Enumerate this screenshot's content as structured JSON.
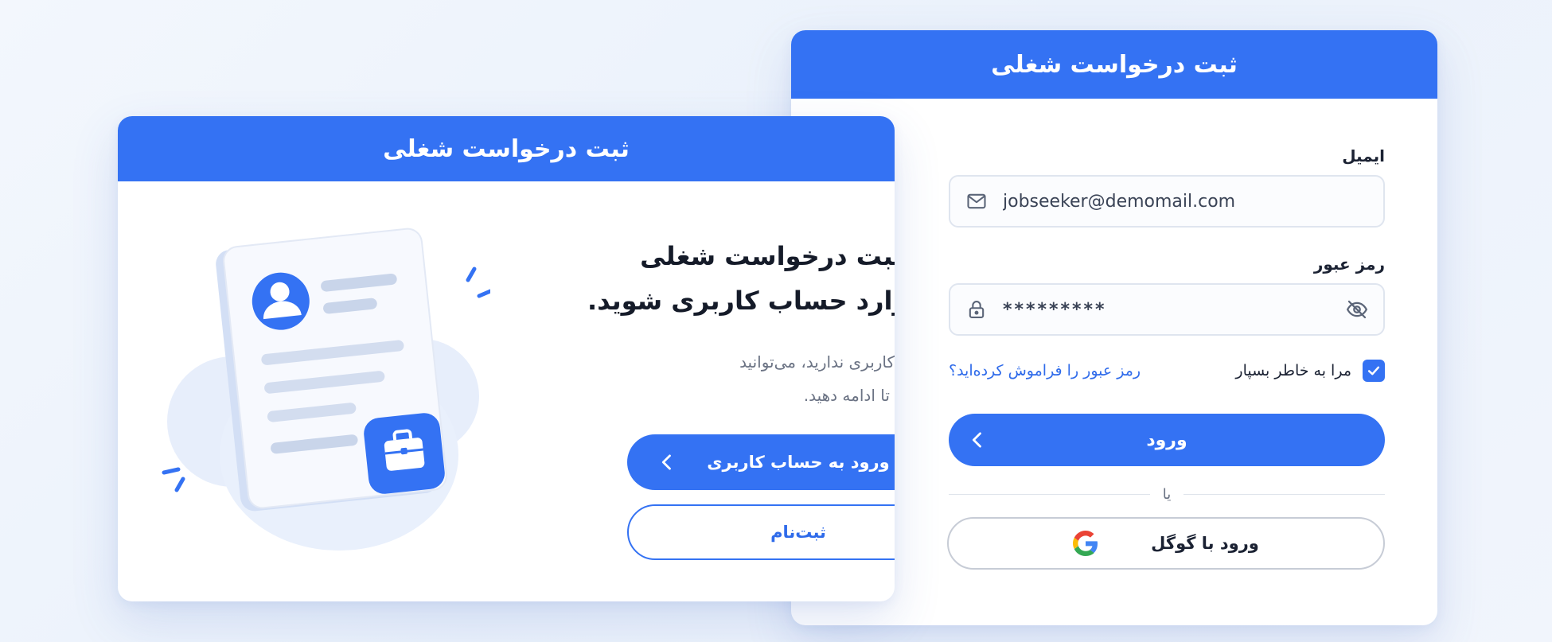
{
  "login_card": {
    "header_title": "ثبت درخواست شغلی",
    "email": {
      "label": "ایمیل",
      "value": "jobseeker@demomail.com"
    },
    "password": {
      "label": "رمز عبور",
      "value": "*********"
    },
    "remember_me": {
      "label": "مرا به خاطر بسپار",
      "checked": true
    },
    "forgot_password": "رمز عبور را فراموش کرده‌اید؟",
    "login_button": "ورود",
    "divider_text": "یا",
    "google_button": "ورود با گوگل"
  },
  "welcome_card": {
    "header_title": "ثبت درخواست شغلی",
    "title_line1": "برای ثبت درخواست شغلی",
    "title_line2": "ابتدا وارد حساب کاربری شوید.",
    "desc_line1": "اگر حساب کاربری ندارید، می‌توانید",
    "desc_line2": "ثبت‌نام کنید تا ادامه دهید.",
    "login_account_button": "ورود به حساب کاربری",
    "register_button": "ثبت‌نام"
  },
  "colors": {
    "primary": "#3472f3",
    "link": "#2f6bea",
    "text_dark": "#1b2233",
    "text_muted": "#6b7384"
  }
}
